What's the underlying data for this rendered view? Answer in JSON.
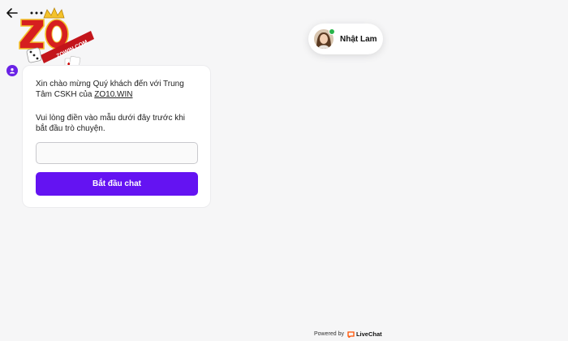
{
  "header": {
    "back_icon": "arrow-left-icon",
    "menu_icon": "more-horizontal-icon"
  },
  "logo": {
    "text": "ZO",
    "subtext": "ZOWIN.COM"
  },
  "agent": {
    "name": "Nhật Lam",
    "status_color": "#28b44a"
  },
  "chat": {
    "welcome_text": "Xin chào mừng Quý khách đến với Trung Tâm CSKH của ",
    "welcome_link": "ZO10.WIN",
    "prompt_text": "Vui lòng điền vào mẫu dưới đây trước khi bắt đầu trò chuyện.",
    "input_value": "",
    "start_button": "Bắt đầu chat",
    "accent_color": "#6413f2"
  },
  "footer": {
    "powered_by": "Powered by",
    "brand": "LiveChat"
  }
}
